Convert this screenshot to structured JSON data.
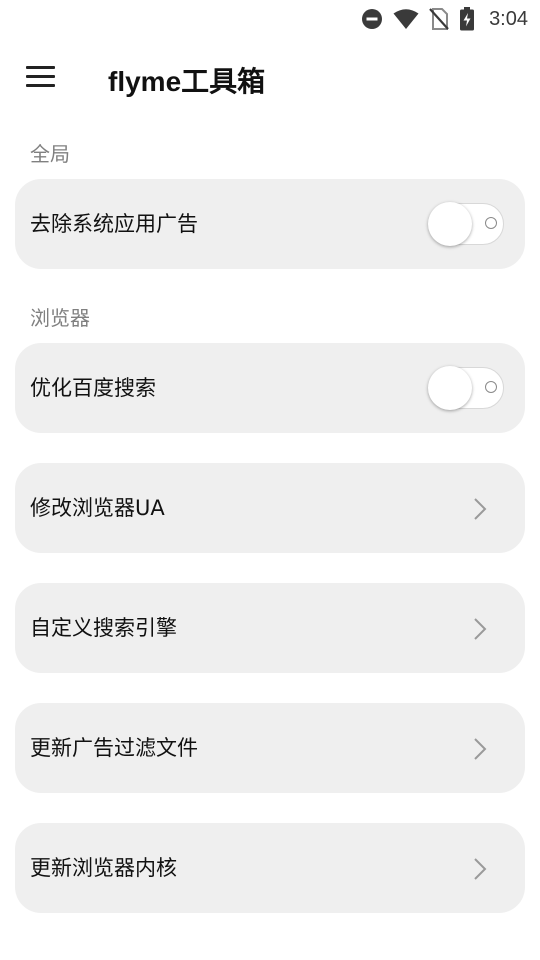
{
  "status_bar": {
    "time": "3:04",
    "icons": [
      "do-not-disturb-icon",
      "wifi-icon",
      "no-sim-icon",
      "battery-charging-icon"
    ]
  },
  "app_bar": {
    "title": "flyme工具箱",
    "menu_icon": "hamburger-menu-icon"
  },
  "sections": {
    "global": {
      "title": "全局",
      "items": [
        {
          "label": "去除系统应用广告",
          "type": "toggle",
          "enabled": false
        }
      ]
    },
    "browser": {
      "title": "浏览器",
      "items": [
        {
          "label": "优化百度搜索",
          "type": "toggle",
          "enabled": false
        },
        {
          "label": "修改浏览器UA",
          "type": "link",
          "icon": "chevron-right-icon"
        },
        {
          "label": "自定义搜索引擎",
          "type": "link",
          "icon": "chevron-right-icon"
        },
        {
          "label": "更新广告过滤文件",
          "type": "link",
          "icon": "chevron-right-icon"
        },
        {
          "label": "更新浏览器内核",
          "type": "link",
          "icon": "chevron-right-icon"
        }
      ]
    }
  },
  "colors": {
    "card_background": "#efefef",
    "section_title": "#808080",
    "text": "#111111",
    "chevron": "#9a9a9a"
  }
}
